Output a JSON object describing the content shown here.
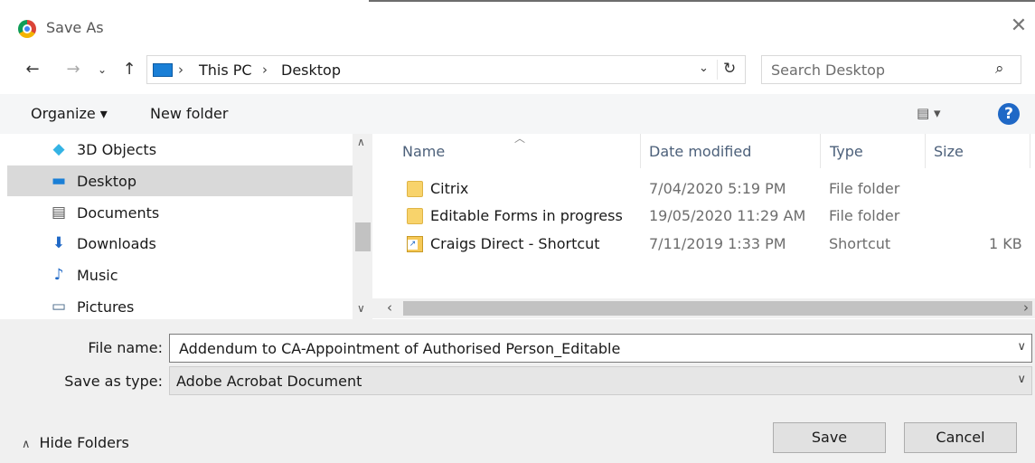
{
  "window": {
    "title": "Save As",
    "close_glyph": "✕"
  },
  "nav": {
    "back_glyph": "←",
    "forward_glyph": "→",
    "recent_glyph": "⌄",
    "up_glyph": "↑",
    "breadcrumb": [
      "This PC",
      "Desktop"
    ],
    "chevron": "›",
    "dropdown_glyph": "⌄",
    "refresh_glyph": "↻"
  },
  "search": {
    "placeholder": "Search Desktop",
    "icon_glyph": "⌕"
  },
  "toolbar": {
    "organize_label": "Organize ▾",
    "new_folder_label": "New folder",
    "view_glyph": "▤ ▾",
    "help_glyph": "?"
  },
  "sidebar": {
    "items": [
      {
        "label": "3D Objects",
        "icon": "cube-icon",
        "icon_glyph": "◆",
        "color": "#34b3e4"
      },
      {
        "label": "Desktop",
        "icon": "desktop-icon",
        "icon_glyph": "▬",
        "color": "#1a7fd6",
        "selected": true
      },
      {
        "label": "Documents",
        "icon": "document-icon",
        "icon_glyph": "▤",
        "color": "#555555"
      },
      {
        "label": "Downloads",
        "icon": "download-icon",
        "icon_glyph": "⬇",
        "color": "#1f68c6"
      },
      {
        "label": "Music",
        "icon": "music-icon",
        "icon_glyph": "♪",
        "color": "#1f68c6"
      },
      {
        "label": "Pictures",
        "icon": "picture-icon",
        "icon_glyph": "▭",
        "color": "#4a6a8a"
      }
    ]
  },
  "columns": {
    "name": "Name",
    "date": "Date modified",
    "type": "Type",
    "size": "Size"
  },
  "files": [
    {
      "name": "Citrix",
      "date": "7/04/2020 5:19 PM",
      "type": "File folder",
      "size": "",
      "icon": "folder"
    },
    {
      "name": "Editable Forms in progress",
      "date": "19/05/2020 11:29 AM",
      "type": "File folder",
      "size": "",
      "icon": "folder"
    },
    {
      "name": "Craigs Direct - Shortcut",
      "date": "7/11/2019 1:33 PM",
      "type": "Shortcut",
      "size": "1 KB",
      "icon": "shortcut"
    }
  ],
  "form": {
    "file_name_label": "File name:",
    "file_name_value": "Addendum to CA-Appointment of Authorised Person_Editable",
    "save_type_label": "Save as type:",
    "save_type_value": "Adobe Acrobat Document"
  },
  "footer": {
    "hide_folders_label": "Hide Folders",
    "hide_caret": "∧",
    "save_label": "Save",
    "cancel_label": "Cancel"
  },
  "colors": {
    "accent": "#1f68c6",
    "selection": "#d9d9d9",
    "bottom_bg": "#f0f0f0"
  }
}
